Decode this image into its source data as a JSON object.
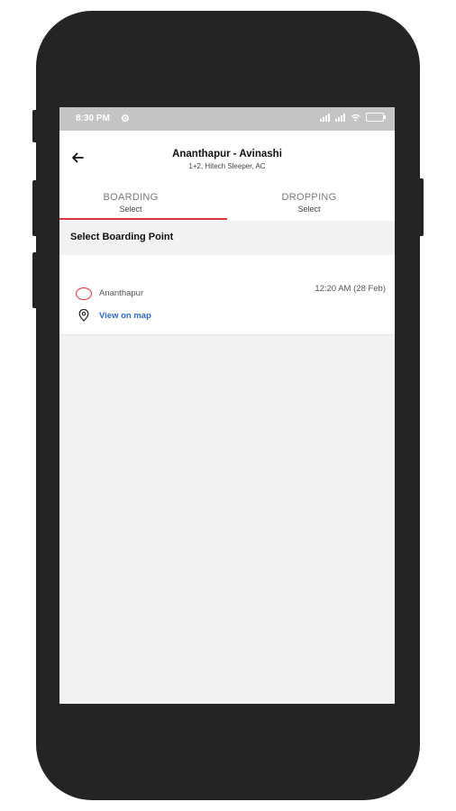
{
  "status_bar": {
    "time": "8:30 PM",
    "gear_glyph": "⚙"
  },
  "header": {
    "route_title": "Ananthapur - Avinashi",
    "route_subtitle": "1+2, Hitech Sleeper, AC"
  },
  "tabs": [
    {
      "label": "BOARDING",
      "sub": "Select",
      "active": true
    },
    {
      "label": "DROPPING",
      "sub": "Select",
      "active": false
    }
  ],
  "section": {
    "title": "Select Boarding Point"
  },
  "boarding_points": [
    {
      "name": "Ananthapur",
      "time": "12:20 AM (28 Feb)",
      "map_link": "View on map"
    }
  ],
  "colors": {
    "accent": "#d9363e",
    "link": "#2c6cc7",
    "phone_body": "#242424",
    "status_bar": "#c4c4c4"
  },
  "icons": [
    "back-arrow-icon",
    "radio-unchecked-icon",
    "map-pin-icon",
    "signal-icon",
    "wifi-icon",
    "battery-icon"
  ]
}
